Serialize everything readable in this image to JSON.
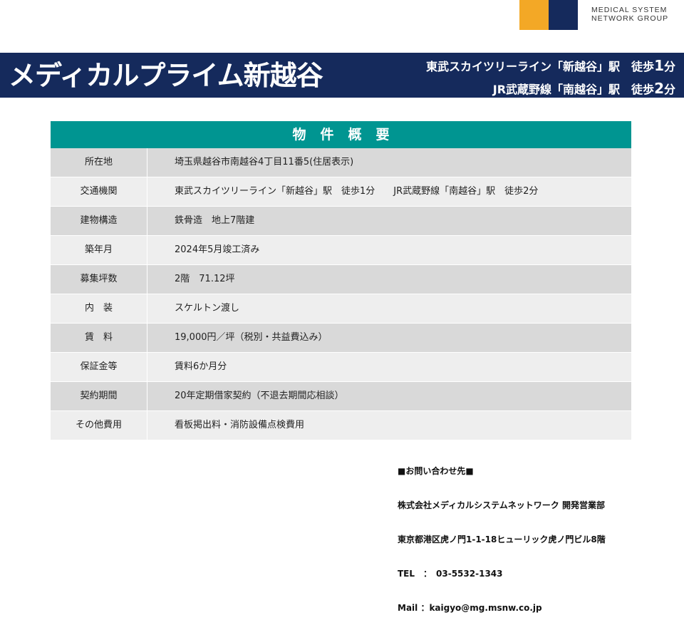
{
  "logo": {
    "line1": "MEDICAL SYSTEM",
    "line2": "NETWORK GROUP",
    "colors": {
      "orange": "#f3a826",
      "navy": "#152a5c"
    }
  },
  "header": {
    "title": "メディカルプライム新越谷",
    "station1": {
      "text": "東武スカイツリーライン「新越谷」駅　徒歩",
      "num": "1",
      "unit": "分"
    },
    "station2": {
      "text": "JR武蔵野線「南越谷」駅　徒歩",
      "num": "2",
      "unit": "分"
    }
  },
  "table": {
    "heading": "物件概要",
    "rows": [
      {
        "label": "所在地",
        "value": "埼玉県越谷市南越谷4丁目11番5(住居表示)"
      },
      {
        "label": "交通機関",
        "value": "東武スカイツリーライン「新越谷」駅　徒歩1分　　JR武蔵野線「南越谷」駅　徒歩2分"
      },
      {
        "label": "建物構造",
        "value": "鉄骨造　地上7階建"
      },
      {
        "label": "築年月",
        "value": "2024年5月竣工済み"
      },
      {
        "label": "募集坪数",
        "value": "2階　71.12坪"
      },
      {
        "label": "内　装",
        "value": "スケルトン渡し"
      },
      {
        "label": "賃　料",
        "value": "19,000円／坪（税別・共益費込み）"
      },
      {
        "label": "保証金等",
        "value": "賃料6か月分"
      },
      {
        "label": "契約期間",
        "value": "20年定期借家契約（不退去期間応相談）"
      },
      {
        "label": "その他費用",
        "value": "看板掲出料・消防設備点検費用"
      }
    ]
  },
  "contact": {
    "heading": "■お問い合わせ先■",
    "company": "株式会社メディカルシステムネットワーク 開発営業部",
    "address": "東京都港区虎ノ門1-1-18ヒューリック虎ノ門ビル8階",
    "tel": "TEL　：　03-5532-1343",
    "mail": "Mail ：kaigyo@mg.msnw.co.jp"
  }
}
